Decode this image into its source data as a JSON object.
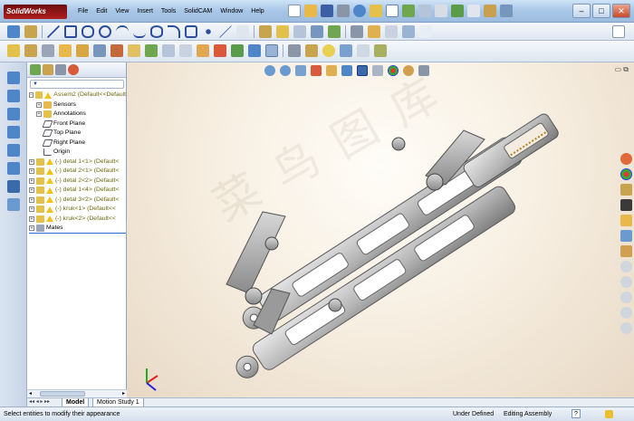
{
  "app": {
    "name": "SolidWorks"
  },
  "menu": [
    "File",
    "Edit",
    "View",
    "Insert",
    "Tools",
    "SolidCAM",
    "Window",
    "Help"
  ],
  "tree": {
    "items": [
      {
        "label": "Assem2  (Default<<Default",
        "type": "root"
      },
      {
        "label": "Sensors",
        "type": "folder"
      },
      {
        "label": "Annotations",
        "type": "folder"
      },
      {
        "label": "Front Plane",
        "type": "plane"
      },
      {
        "label": "Top Plane",
        "type": "plane"
      },
      {
        "label": "Right Plane",
        "type": "plane"
      },
      {
        "label": "Origin",
        "type": "origin"
      },
      {
        "label": "(-) detal 1<1> (Default<",
        "type": "part"
      },
      {
        "label": "(-) detal 2<1> (Default<",
        "type": "part"
      },
      {
        "label": "(-) detal 2<2> (Default<",
        "type": "part"
      },
      {
        "label": "(-) detal 1<4> (Default<",
        "type": "part"
      },
      {
        "label": "(-) detal 3<2> (Default<",
        "type": "part"
      },
      {
        "label": "(-) kruk<1> (Default<<",
        "type": "part"
      },
      {
        "label": "(-) kruk<2> (Default<<",
        "type": "part"
      },
      {
        "label": "Mates",
        "type": "mates"
      }
    ]
  },
  "tabs": {
    "model": "Model",
    "motion": "Motion Study 1"
  },
  "status": {
    "hint": "Select entities to modify their appearance",
    "defined": "Under Defined",
    "mode": "Editing Assembly",
    "help": "?"
  },
  "watermark": [
    "菜",
    "鸟",
    "图",
    "库"
  ]
}
